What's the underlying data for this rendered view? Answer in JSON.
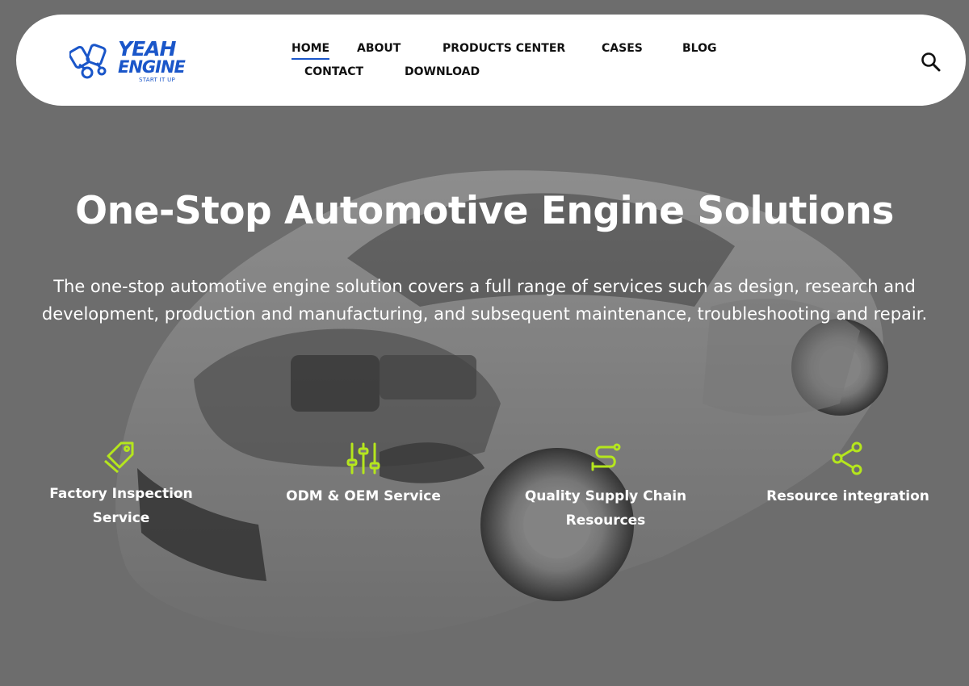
{
  "brand": {
    "name_line1": "YEAH",
    "name_line2": "ENGINE",
    "tagline": "START IT UP",
    "color": "#1a56c9"
  },
  "nav": {
    "items": [
      {
        "label": "HOME",
        "active": true
      },
      {
        "label": "ABOUT"
      },
      {
        "label": "PRODUCTS CENTER"
      },
      {
        "label": "CASES"
      },
      {
        "label": "BLOG"
      },
      {
        "label": "CONTACT"
      },
      {
        "label": "DOWNLOAD"
      }
    ],
    "search_icon": "search-icon"
  },
  "hero": {
    "title": "One-Stop Automotive Engine Solutions",
    "description": "The one-stop automotive engine solution covers a full range of services such as design, research and development, production and manufacturing, and subsequent maintenance, troubleshooting and repair.",
    "background": "transparent sports car with visible engine"
  },
  "features": [
    {
      "label": "Factory Inspection Service",
      "icon": "tag-icon"
    },
    {
      "label": "ODM & OEM Service",
      "icon": "sliders-icon"
    },
    {
      "label": "Quality Supply Chain Resources",
      "icon": "route-icon"
    },
    {
      "label": "Resource integration",
      "icon": "share-icon"
    }
  ],
  "colors": {
    "accent": "#b5e61d",
    "brand": "#1a56c9",
    "text": "#ffffff"
  }
}
